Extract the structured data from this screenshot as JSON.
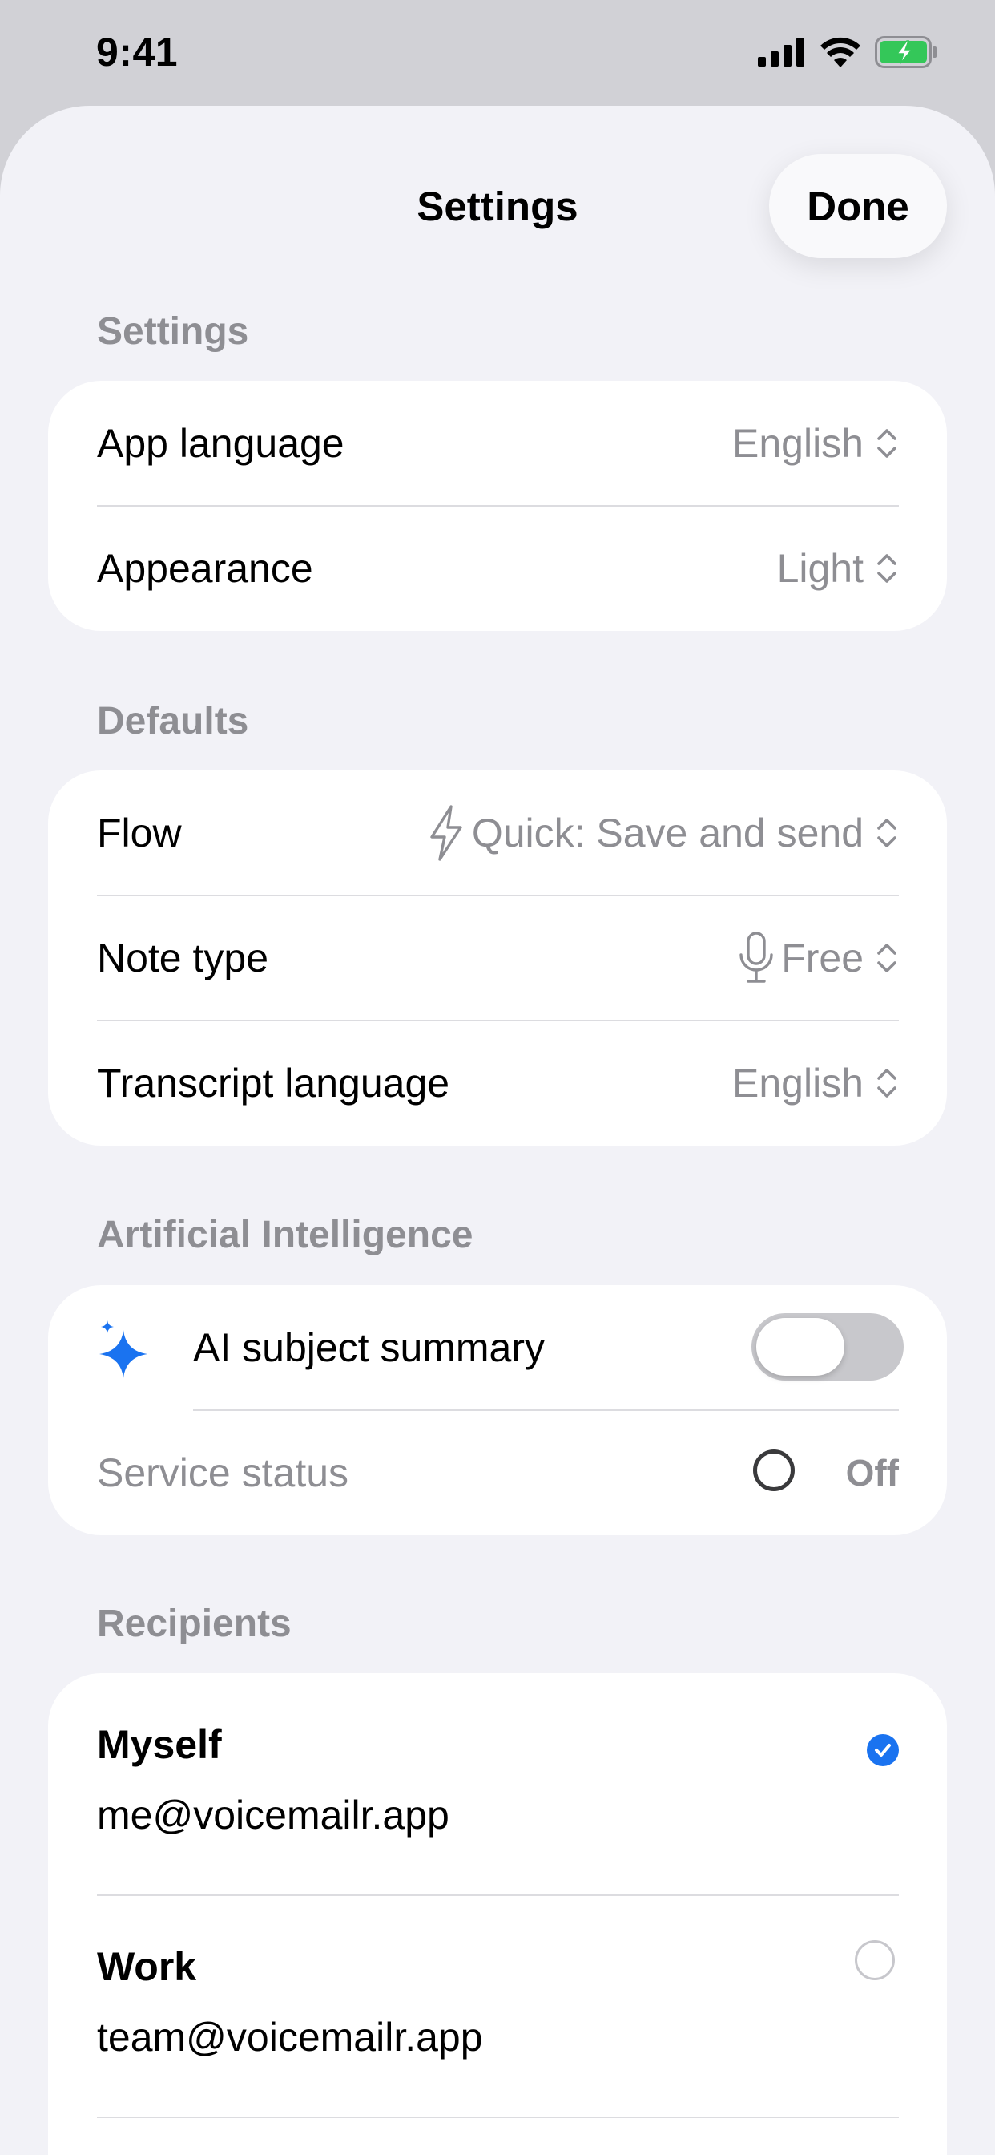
{
  "status_bar": {
    "time": "9:41",
    "icons": [
      "cellular-signal-icon",
      "wifi-icon",
      "battery-charging-icon"
    ],
    "battery_color": "#34c759"
  },
  "header": {
    "title": "Settings",
    "done_label": "Done"
  },
  "sections": {
    "settings": {
      "header": "Settings",
      "rows": [
        {
          "label": "App language",
          "value": "English"
        },
        {
          "label": "Appearance",
          "value": "Light"
        }
      ]
    },
    "defaults": {
      "header": "Defaults",
      "rows": [
        {
          "label": "Flow",
          "value": "Quick: Save and send",
          "icon": "bolt-icon"
        },
        {
          "label": "Note type",
          "value": "Free",
          "icon": "microphone-icon"
        },
        {
          "label": "Transcript language",
          "value": "English"
        }
      ]
    },
    "ai": {
      "header": "Artificial Intelligence",
      "summary_label": "AI subject summary",
      "summary_icon": "sparkles-icon",
      "summary_enabled": false,
      "status_label": "Service status",
      "status_value": "Off",
      "accent_color": "#1a73f0"
    },
    "recipients": {
      "header": "Recipients",
      "items": [
        {
          "name": "Myself",
          "email": "me@voicemailr.app",
          "selected": true
        },
        {
          "name": "Work",
          "email": "team@voicemailr.app",
          "selected": false
        }
      ]
    }
  }
}
